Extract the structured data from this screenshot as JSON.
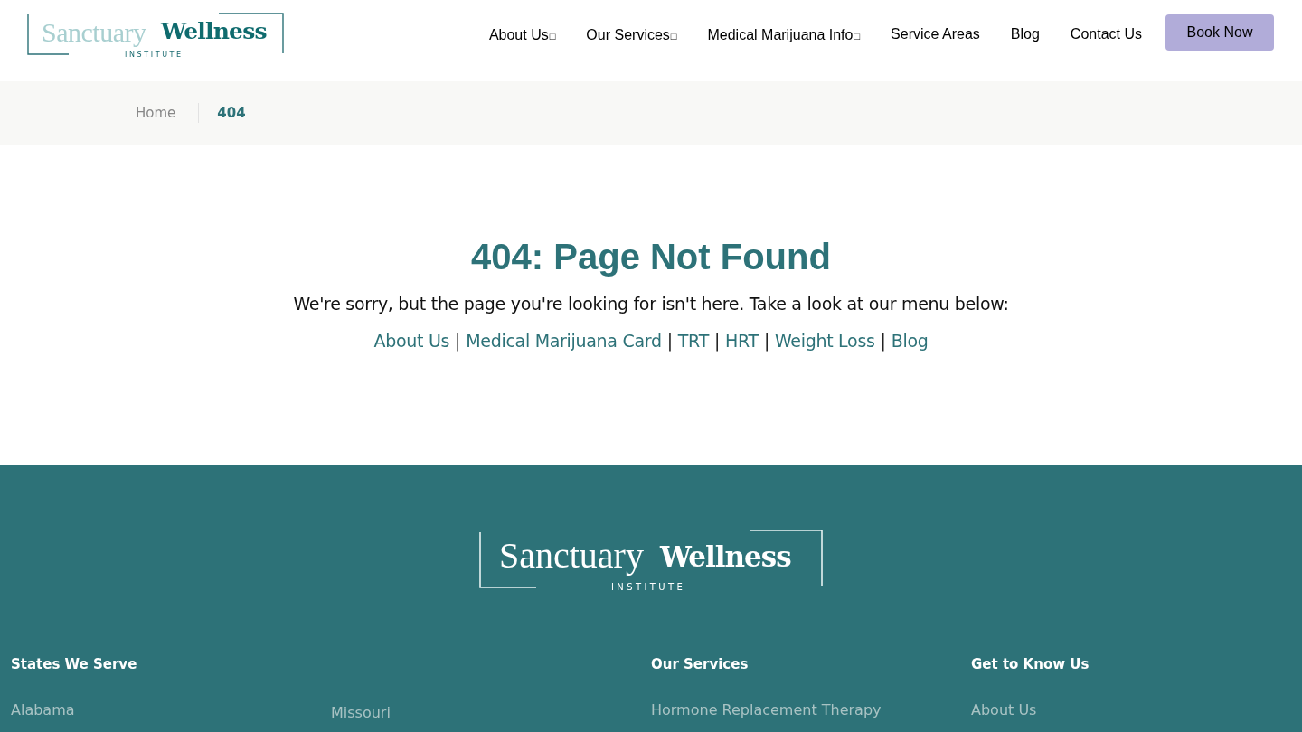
{
  "header": {
    "logo": {
      "light": "Sanctuary",
      "bold": "Wellness",
      "sub": "INSTITUTE"
    },
    "nav": [
      {
        "label": "About Us",
        "menu_glyph": "□"
      },
      {
        "label": "Our Services",
        "menu_glyph": "□"
      },
      {
        "label": "Medical Marijuana Info",
        "menu_glyph": "□"
      },
      {
        "label": "Service Areas"
      },
      {
        "label": "Blog"
      },
      {
        "label": "Contact Us"
      }
    ],
    "cta": "Book Now"
  },
  "breadcrumb": [
    {
      "label": "Home",
      "current": false
    },
    {
      "label": "404",
      "current": true
    }
  ],
  "main": {
    "title": "404: Page Not Found",
    "message": "We're sorry, but the page you're looking for isn't here. Take a look at our menu below:",
    "links": [
      "About Us",
      "Medical Marijuana Card",
      "TRT",
      "HRT",
      "Weight Loss",
      "Blog"
    ],
    "separator": "|"
  },
  "footer": {
    "logo": {
      "light": "Sanctuary",
      "bold": "Wellness",
      "sub": "INSTITUTE"
    },
    "columns": [
      {
        "heading": "States We Serve",
        "links": [
          "Alabama"
        ]
      },
      {
        "links": [
          "Missouri"
        ]
      },
      {
        "heading": "Our Services",
        "links": [
          "Hormone Replacement Therapy"
        ]
      },
      {
        "heading": "Get to Know Us",
        "links": [
          "About Us"
        ]
      }
    ]
  }
}
